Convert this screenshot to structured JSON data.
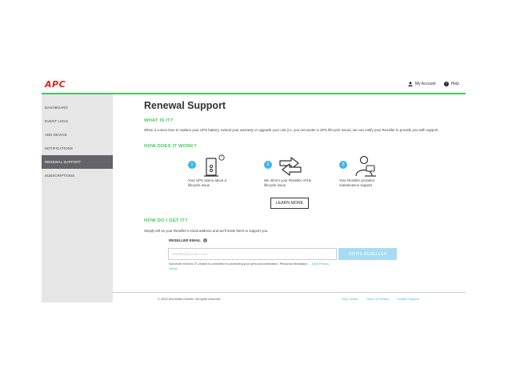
{
  "header": {
    "logo": "APC",
    "my_account": "My Account",
    "help": "Help"
  },
  "sidebar": {
    "items": [
      {
        "label": "DASHBOARD"
      },
      {
        "label": "EVENT LOGS"
      },
      {
        "label": "ADD DEVICE"
      },
      {
        "label": "NOTIFICATIONS"
      },
      {
        "label": "RENEWAL SUPPORT",
        "active": true
      },
      {
        "label": "SUBSCRIPTIONS"
      }
    ]
  },
  "main": {
    "title": "Renewal Support",
    "what_heading": "WHAT IS IT?",
    "what_text": "When it comes time to replace your UPS battery, extend your warranty or upgrade your unit (i.e. you encounter a UPS lifecycle issue), we can notify your Reseller to provide you with support.",
    "how_heading": "HOW DOES IT WORK?",
    "steps": [
      {
        "number": "1",
        "caption": "Your UPS warns about a lifecycle issue",
        "icon": "ups-battery-warning-icon"
      },
      {
        "number": "2",
        "caption": "We inform your Reseller of the lifecycle issue",
        "icon": "transfer-arrows-icon"
      },
      {
        "number": "3",
        "caption": "Your Reseller provides maintenance support",
        "icon": "support-person-icon"
      }
    ],
    "learn_more": "LEARN MORE",
    "get_heading": "HOW DO I GET IT?",
    "get_text": "Simply tell us your Reseller's email address and we'll invite them to support you.",
    "reseller_label": "RESELLER EMAIL",
    "email_placeholder": "reseller@domain.com",
    "invite_button": "INVITE RESELLER",
    "privacy_text": "Schneider Electric IT Limited is committed to protecting your personal information. Personal information ... ",
    "privacy_link": "Data Privacy Notice"
  },
  "footer": {
    "copyright": "© 2020 Schneider Electric. All rights reserved.",
    "links": [
      "Help Center",
      "Terms & Privacy",
      "Contact Support"
    ]
  },
  "colors": {
    "brand_red": "#e2231a",
    "accent_green": "#3dcd58",
    "accent_blue": "#42b4e6",
    "sidebar_active": "#626469"
  }
}
